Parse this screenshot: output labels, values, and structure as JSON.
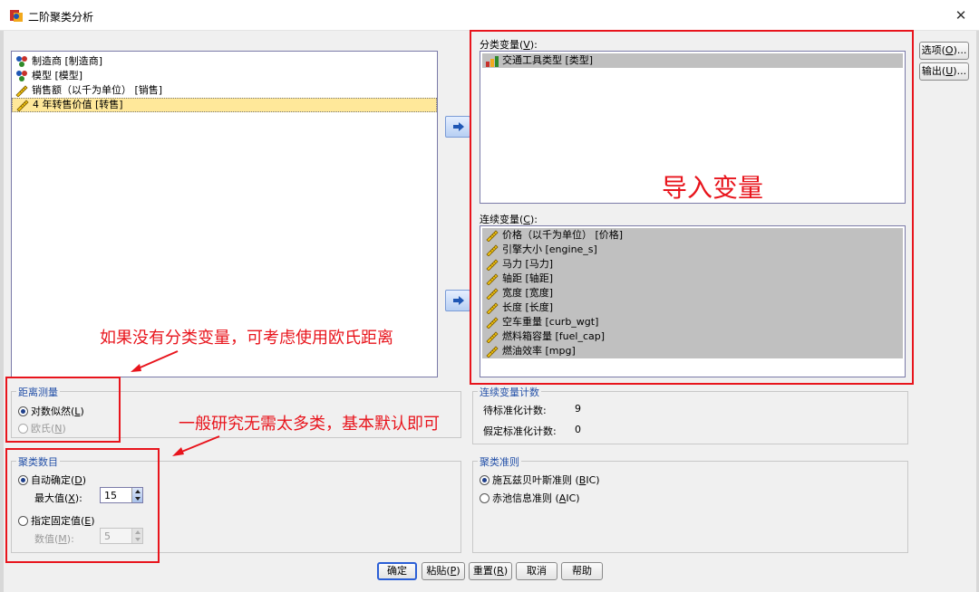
{
  "window": {
    "title": "二阶聚类分析"
  },
  "source_list": {
    "items": [
      {
        "label": "制造商 [制造商]",
        "icon": "nominal-icon",
        "selected": false
      },
      {
        "label": "模型 [模型]",
        "icon": "nominal-icon",
        "selected": false
      },
      {
        "label": "销售额（以千为单位） [销售]",
        "icon": "scale-ruler-icon",
        "selected": false
      },
      {
        "label": "4 年转售价值 [转售]",
        "icon": "scale-ruler-icon",
        "selected": true
      }
    ]
  },
  "categorical": {
    "label_prefix": "分类变量(",
    "label_key": "V",
    "label_suffix": "):",
    "items": [
      {
        "label": "交通工具类型 [类型]",
        "icon": "ordinal-bar-icon"
      }
    ]
  },
  "continuous": {
    "label_prefix": "连续变量(",
    "label_key": "C",
    "label_suffix": "):",
    "items": [
      {
        "label": "价格（以千为单位） [价格]",
        "icon": "scale-ruler-icon"
      },
      {
        "label": "引擎大小 [engine_s]",
        "icon": "scale-ruler-icon"
      },
      {
        "label": "马力 [马力]",
        "icon": "scale-ruler-icon"
      },
      {
        "label": "轴距 [轴距]",
        "icon": "scale-ruler-icon"
      },
      {
        "label": "宽度 [宽度]",
        "icon": "scale-ruler-icon"
      },
      {
        "label": "长度 [长度]",
        "icon": "scale-ruler-icon"
      },
      {
        "label": "空车重量 [curb_wgt]",
        "icon": "scale-ruler-icon"
      },
      {
        "label": "燃料箱容量 [fuel_cap]",
        "icon": "scale-ruler-icon"
      },
      {
        "label": "燃油效率 [mpg]",
        "icon": "scale-ruler-icon"
      }
    ]
  },
  "side_buttons": {
    "options": {
      "prefix": "选项(",
      "key": "O",
      "suffix": ")..."
    },
    "output": {
      "prefix": "输出(",
      "key": "U",
      "suffix": ")..."
    }
  },
  "distance": {
    "title": "距离测量",
    "loglik": {
      "prefix": "对数似然(",
      "key": "L",
      "suffix": ")",
      "checked": true
    },
    "euclid": {
      "prefix": "欧氏(",
      "key": "N",
      "suffix": ")",
      "checked": false
    }
  },
  "count": {
    "title": "连续变量计数",
    "to_std_label": "待标准化计数:",
    "to_std_value": "9",
    "assumed_label": "假定标准化计数:",
    "assumed_value": "0"
  },
  "clusters": {
    "title": "聚类数目",
    "auto": {
      "prefix": "自动确定(",
      "key": "D",
      "suffix": ")",
      "checked": true
    },
    "max": {
      "prefix": "最大值(",
      "key": "X",
      "suffix": "):",
      "value": "15"
    },
    "fixed": {
      "prefix": "指定固定值(",
      "key": "E",
      "suffix": ")",
      "checked": false
    },
    "number": {
      "prefix": "数值(",
      "key": "M",
      "suffix": "):",
      "value": "5"
    }
  },
  "criterion": {
    "title": "聚类准则",
    "bic": {
      "prefix": "施瓦兹贝叶斯准则 (",
      "key": "B",
      "suffix": "IC)",
      "checked": true
    },
    "aic": {
      "prefix": "赤池信息准则 (",
      "key": "A",
      "suffix": "IC)",
      "checked": false
    }
  },
  "bottom_buttons": {
    "ok": {
      "label": "确定"
    },
    "paste": {
      "prefix": "粘贴(",
      "key": "P",
      "suffix": ")"
    },
    "reset": {
      "prefix": "重置(",
      "key": "R",
      "suffix": ")"
    },
    "cancel": {
      "label": "取消"
    },
    "help": {
      "label": "帮助"
    }
  },
  "annotations": {
    "import_vars": "导入变量",
    "no_categorical": "如果没有分类变量，可考虑使用欧氏距离",
    "no_many_clusters": "一般研究无需太多类，基本默认即可"
  },
  "colors": {
    "annotation_red": "#e8141c",
    "group_title_blue": "#2350a8",
    "selection_yellow": "#ffe89a"
  }
}
